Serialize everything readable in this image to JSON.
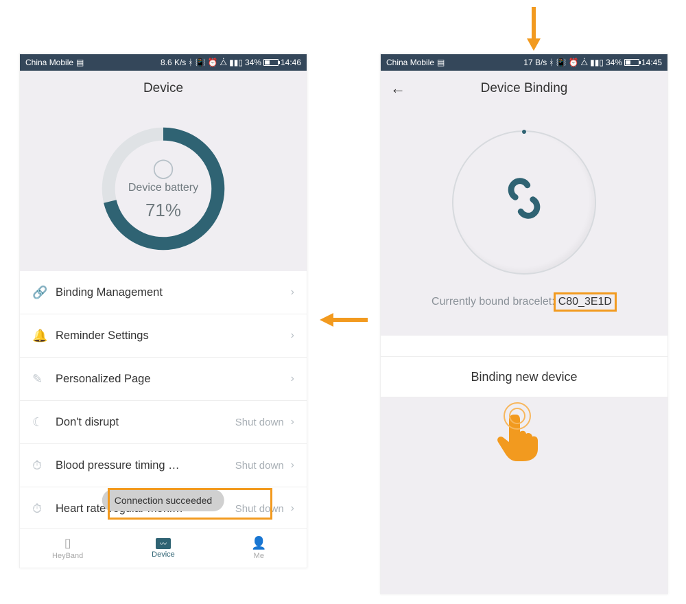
{
  "colors": {
    "accent": "#2f6373",
    "highlight": "#f29a1f"
  },
  "leftPhone": {
    "status": {
      "carrier": "China Mobile",
      "speed": "8.6 K/s",
      "batteryPct": "34%",
      "time": "14:46",
      "batteryFill": 34
    },
    "header": {
      "title": "Device"
    },
    "battery": {
      "label": "Device battery",
      "percentText": "71%",
      "percent": 71
    },
    "menu": [
      {
        "icon": "🔗",
        "label": "Binding Management",
        "value": ""
      },
      {
        "icon": "🔔",
        "label": "Reminder Settings",
        "value": ""
      },
      {
        "icon": "✎",
        "label": "Personalized Page",
        "value": ""
      },
      {
        "icon": "☾",
        "label": "Don't disrupt",
        "value": "Shut down"
      },
      {
        "icon": "⏱",
        "label": "Blood pressure timing …",
        "value": "Shut down"
      },
      {
        "icon": "⏱",
        "label": "Heart rate regular moni…",
        "value": "Shut down"
      }
    ],
    "toast": "Connection succeeded",
    "nav": [
      {
        "label": "HeyBand",
        "active": false
      },
      {
        "label": "Device",
        "active": true
      },
      {
        "label": "Me",
        "active": false
      }
    ]
  },
  "rightPhone": {
    "status": {
      "carrier": "China Mobile",
      "speed": "17 B/s",
      "batteryPct": "34%",
      "time": "14:45",
      "batteryFill": 34
    },
    "header": {
      "title": "Device Binding",
      "back": "←"
    },
    "boundLabel": "Currently bound bracelet:",
    "boundId": "C80_3E1D",
    "bindButton": "Binding new device"
  }
}
